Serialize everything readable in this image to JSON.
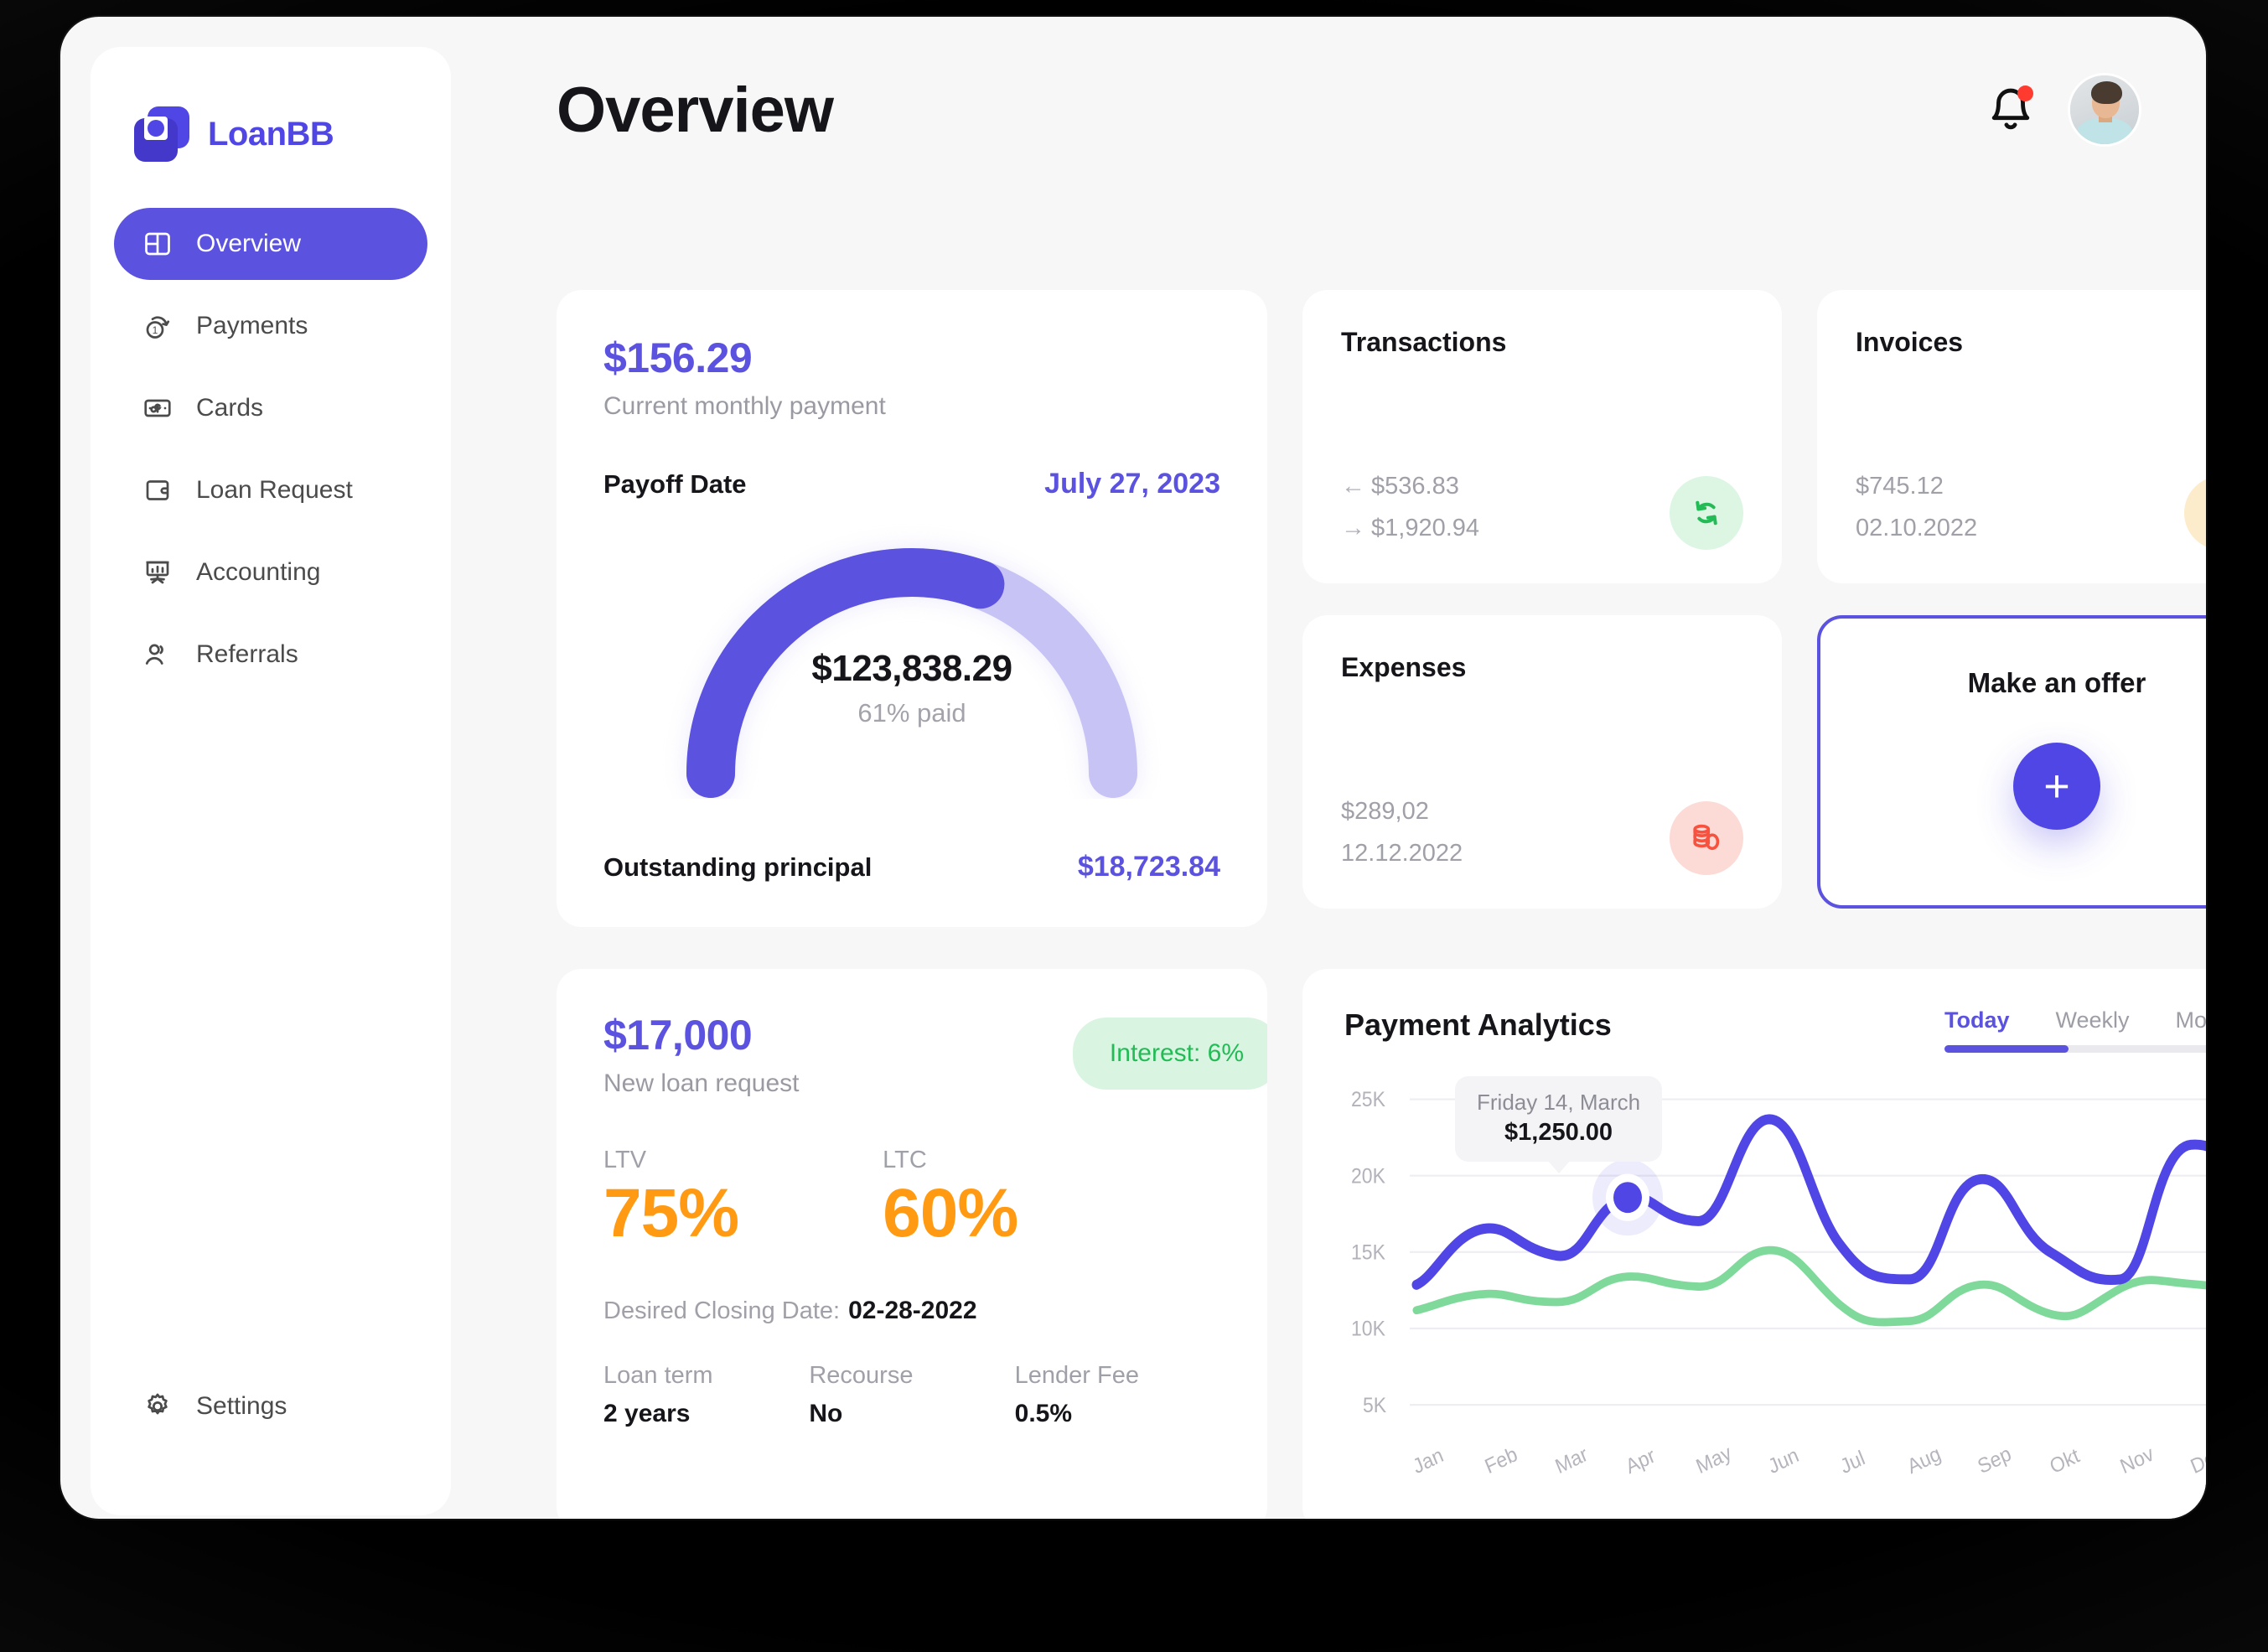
{
  "brand": {
    "name": "LoanBB",
    "logo_icon": "loanbb-logo-icon",
    "accent": "#4f46e5"
  },
  "sidebar": {
    "items": [
      {
        "label": "Overview",
        "icon": "layout-dashboard-icon",
        "active": true
      },
      {
        "label": "Payments",
        "icon": "coin-refresh-icon",
        "active": false
      },
      {
        "label": "Cards",
        "icon": "money-card-icon",
        "active": false
      },
      {
        "label": "Loan Request",
        "icon": "wallet-icon",
        "active": false
      },
      {
        "label": "Accounting",
        "icon": "presentation-chart-icon",
        "active": false
      },
      {
        "label": "Referrals",
        "icon": "users-icon",
        "active": false
      }
    ],
    "settings": {
      "label": "Settings",
      "icon": "gear-icon"
    }
  },
  "header": {
    "title": "Overview",
    "notifications_icon": "bell-icon",
    "notifications_badge": true,
    "avatar": "user-avatar"
  },
  "loan_summary": {
    "monthly_payment": "$156.29",
    "monthly_payment_label": "Current monthly payment",
    "payoff_label": "Payoff Date",
    "payoff_value": "July 27, 2023",
    "gauge_amount": "$123,838.29",
    "gauge_paid": "61% paid",
    "gauge_percent": 61,
    "outstanding_label": "Outstanding principal",
    "outstanding_value": "$18,723.84",
    "arc_filled_color": "#5b52e0",
    "arc_track_color": "#c7c3f5"
  },
  "transactions": {
    "title": "Transactions",
    "incoming_arrow": "←",
    "incoming": "$536.83",
    "outgoing_arrow": "→",
    "outgoing": "$1,920.94",
    "icon": "refresh-sync-icon",
    "icon_color": "#22bb55",
    "pill_color": "#dcf6e3"
  },
  "invoices": {
    "title": "Invoices",
    "amount": "$745.12",
    "date": "02.10.2022",
    "icon": "document-icon",
    "icon_color": "#f59f0a",
    "pill_color": "#fdeccb"
  },
  "expenses": {
    "title": "Expenses",
    "amount": "$289,02",
    "date": "12.12.2022",
    "icon": "coins-stack-icon",
    "icon_color": "#f8513e",
    "pill_color": "#fcdad6"
  },
  "offer": {
    "title": "Make an offer",
    "button_icon": "plus-icon",
    "border_color": "#5b52e0"
  },
  "loan_request": {
    "amount": "$17,000",
    "amount_label": "New loan request",
    "interest_badge": "Interest: 6%",
    "ltv_label": "LTV",
    "ltv_value": "75%",
    "ltc_label": "LTC",
    "ltc_value": "60%",
    "closing_label": "Desired Closing Date:",
    "closing_value": "02-28-2022",
    "loan_term_label": "Loan term",
    "loan_term_value": "2 years",
    "recourse_label": "Recourse",
    "recourse_value": "No",
    "lender_fee_label": "Lender Fee",
    "lender_fee_value": "0.5%"
  },
  "analytics": {
    "title": "Payment Analytics",
    "tabs": [
      {
        "label": "Today",
        "active": true
      },
      {
        "label": "Weekly",
        "active": false
      },
      {
        "label": "Monthly",
        "active": false
      }
    ],
    "tooltip": {
      "date": "Friday 14, March",
      "value": "$1,250.00"
    }
  },
  "chart_data": {
    "type": "line",
    "title": "Payment Analytics",
    "xlabel": "",
    "ylabel": "",
    "x": [
      "Jan",
      "Feb",
      "Mar",
      "Apr",
      "May",
      "Jun",
      "Jul",
      "Aug",
      "Sep",
      "Okt",
      "Nov",
      "Dec"
    ],
    "ylim": [
      5000,
      25000
    ],
    "yticks": [
      5000,
      10000,
      15000,
      20000,
      25000
    ],
    "ytick_labels": [
      "5K",
      "10K",
      "15K",
      "20K",
      "25K"
    ],
    "grid": true,
    "legend": "none",
    "series": [
      {
        "name": "Primary",
        "color": "#4f46e5",
        "values": [
          12700,
          15800,
          14400,
          17100,
          22200,
          17800,
          13600,
          19900,
          15600,
          13800,
          20300,
          19600
        ]
      },
      {
        "name": "Secondary",
        "color": "#7fd99a",
        "values": [
          11200,
          12200,
          11700,
          13000,
          14700,
          13100,
          11100,
          13800,
          12200,
          11400,
          13900,
          13500
        ]
      }
    ],
    "highlight": {
      "series": "Primary",
      "x": "Mar",
      "value": 18200,
      "label_date": "Friday 14, March",
      "label_value": "$1,250.00"
    }
  }
}
